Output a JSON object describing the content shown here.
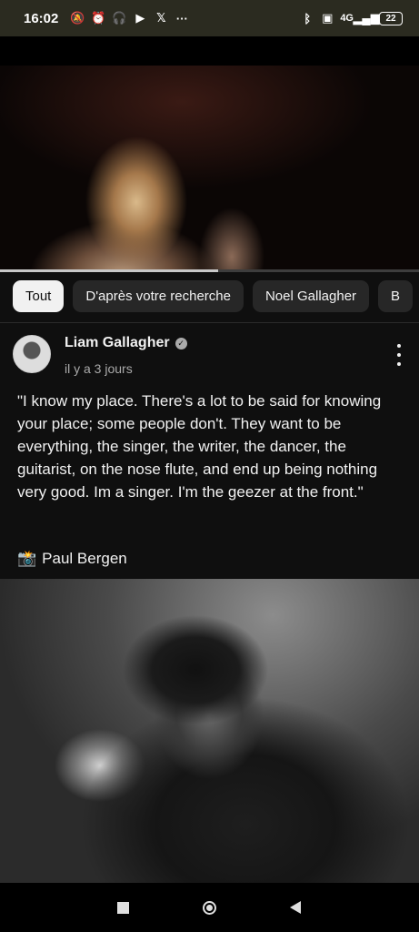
{
  "status_bar": {
    "time": "16:02",
    "network": "4G",
    "battery": "22",
    "icons": [
      "notifications-off-icon",
      "alarm-icon",
      "headphones-icon",
      "youtube-icon",
      "x-icon",
      "more-icon",
      "bluetooth-icon",
      "volte-icon",
      "signal-icon",
      "battery-icon"
    ]
  },
  "video": {
    "progress": 0.52
  },
  "chips": [
    {
      "label": "Tout"
    },
    {
      "label": "D'après votre recherche"
    },
    {
      "label": "Noel Gallagher"
    },
    {
      "label": "B"
    }
  ],
  "post": {
    "author": "Liam Gallagher",
    "time": "il y a 3 jours",
    "text": "\"I know my place. There's a lot to be said for knowing your place; some people don't. They want to be everything, the singer, the writer, the dancer, the guitarist, on the nose flute, and end up being nothing very good. Im a singer. I'm the geezer at the front.\"",
    "credit": "Paul Bergen",
    "credit_icon": "📸"
  },
  "colors": {
    "background": "#0f0f0f",
    "chip": "#272727",
    "chip_active": "#f1f1f1",
    "secondary_text": "#aaaaaa"
  }
}
